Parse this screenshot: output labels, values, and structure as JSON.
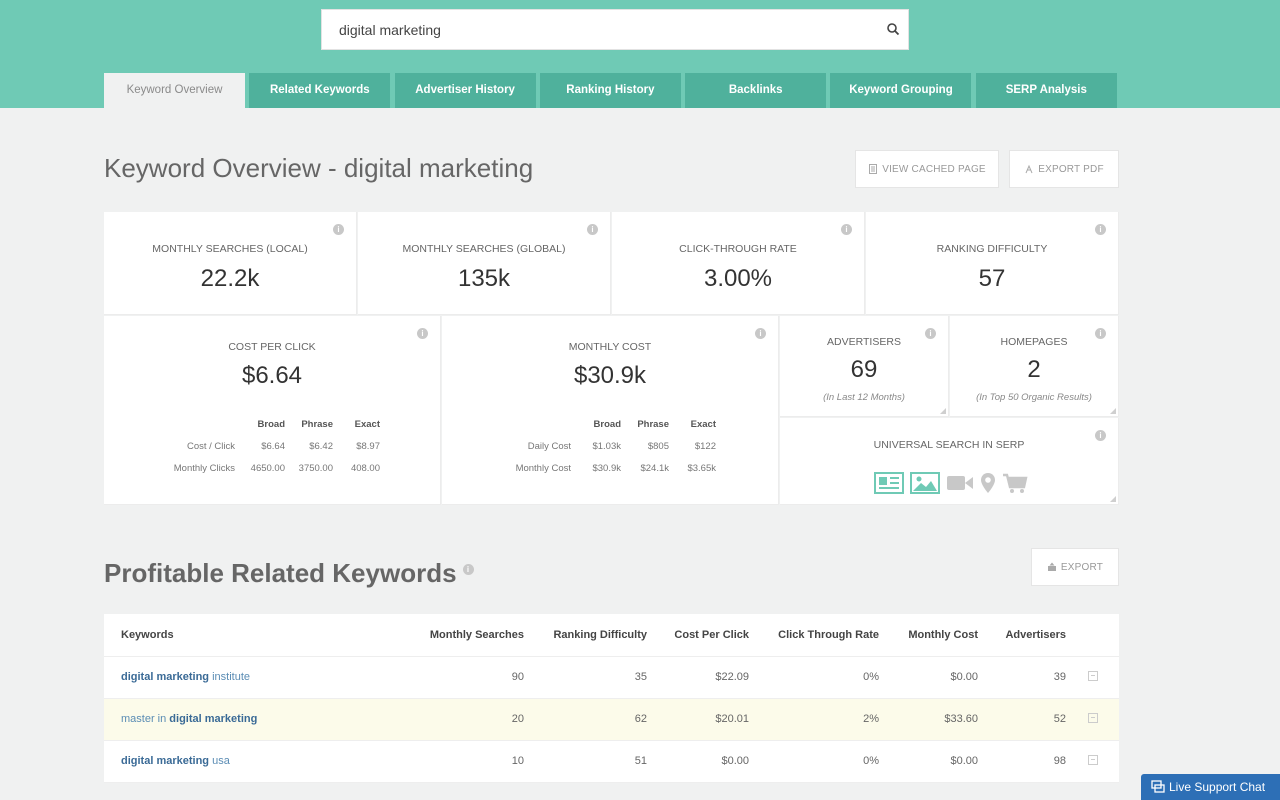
{
  "search": {
    "value": "digital marketing",
    "icon": "search-icon"
  },
  "tabs": [
    {
      "label": "Keyword Overview",
      "active": true
    },
    {
      "label": "Related Keywords"
    },
    {
      "label": "Advertiser History"
    },
    {
      "label": "Ranking History"
    },
    {
      "label": "Backlinks"
    },
    {
      "label": "Keyword Grouping"
    },
    {
      "label": "SERP Analysis"
    }
  ],
  "page": {
    "title": "Keyword Overview - digital marketing",
    "view_cached": "VIEW CACHED PAGE",
    "export_pdf": "EXPORT PDF"
  },
  "metrics": {
    "monthly_local": {
      "label": "MONTHLY SEARCHES (LOCAL)",
      "value": "22.2k"
    },
    "monthly_global": {
      "label": "MONTHLY SEARCHES (GLOBAL)",
      "value": "135k"
    },
    "ctr": {
      "label": "CLICK-THROUGH RATE",
      "value": "3.00%"
    },
    "difficulty": {
      "label": "RANKING DIFFICULTY",
      "value": "57"
    }
  },
  "cpc": {
    "label": "COST PER CLICK",
    "value": "$6.64",
    "headers": [
      "Broad",
      "Phrase",
      "Exact"
    ],
    "rows": [
      {
        "label": "Cost / Click",
        "values": [
          "$6.64",
          "$6.42",
          "$8.97"
        ]
      },
      {
        "label": "Monthly Clicks",
        "values": [
          "4650.00",
          "3750.00",
          "408.00"
        ]
      }
    ]
  },
  "monthly_cost": {
    "label": "MONTHLY COST",
    "value": "$30.9k",
    "headers": [
      "Broad",
      "Phrase",
      "Exact"
    ],
    "rows": [
      {
        "label": "Daily Cost",
        "values": [
          "$1.03k",
          "$805",
          "$122"
        ]
      },
      {
        "label": "Monthly Cost",
        "values": [
          "$30.9k",
          "$24.1k",
          "$3.65k"
        ]
      }
    ]
  },
  "advertisers": {
    "label": "ADVERTISERS",
    "value": "69",
    "sub": "(In Last 12 Months)"
  },
  "homepages": {
    "label": "HOMEPAGES",
    "value": "2",
    "sub": "(In Top 50 Organic Results)"
  },
  "universal": {
    "label": "UNIVERSAL SEARCH IN SERP",
    "icons": [
      "news-icon",
      "image-icon",
      "video-icon",
      "map-pin-icon",
      "shopping-cart-icon"
    ],
    "active_color": "#6fcab5",
    "inactive_color": "#c8c8c8"
  },
  "related": {
    "title": "Profitable Related Keywords",
    "export": "EXPORT",
    "headers": [
      "Keywords",
      "Monthly Searches",
      "Ranking Difficulty",
      "Cost Per Click",
      "Click Through Rate",
      "Monthly Cost",
      "Advertisers"
    ],
    "rows": [
      {
        "kw_parts": [
          [
            "digital marketing",
            true
          ],
          [
            " institute",
            false
          ]
        ],
        "searches": "90",
        "difficulty": "35",
        "cpc": "$22.09",
        "ctr": "0%",
        "cost": "$0.00",
        "advertisers": "39"
      },
      {
        "kw_parts": [
          [
            "master in ",
            false
          ],
          [
            "digital marketing",
            true
          ]
        ],
        "searches": "20",
        "difficulty": "62",
        "cpc": "$20.01",
        "ctr": "2%",
        "cost": "$33.60",
        "advertisers": "52"
      },
      {
        "kw_parts": [
          [
            "digital marketing",
            true
          ],
          [
            " usa",
            false
          ]
        ],
        "searches": "10",
        "difficulty": "51",
        "cpc": "$0.00",
        "ctr": "0%",
        "cost": "$0.00",
        "advertisers": "98"
      }
    ]
  },
  "live_support": "Live Support Chat",
  "colors": {
    "header": "#6fcab5",
    "tab": "#4fb19c",
    "link": "#5a8cb4",
    "chat": "#2d6fb6"
  }
}
